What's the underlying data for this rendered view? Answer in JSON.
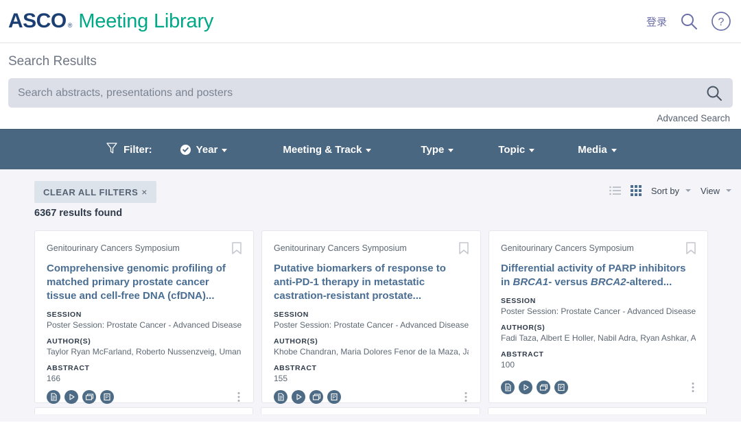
{
  "header": {
    "logo_primary": "ASCO",
    "logo_registered": "®",
    "logo_secondary": "Meeting Library",
    "login_label": "登录",
    "search_icon": "search-icon",
    "help_icon": "help-circle-icon"
  },
  "search": {
    "title": "Search Results",
    "placeholder": "Search abstracts, presentations and posters",
    "value": "",
    "submit_icon": "search-icon",
    "advanced_label": "Advanced Search"
  },
  "filter_bar": {
    "label": "Filter:",
    "funnel_icon": "filter-funnel-icon",
    "background": "#4a6782",
    "items": [
      {
        "label": "Year",
        "active": true,
        "badge_icon": "check-circle-icon"
      },
      {
        "label": "Meeting & Track",
        "active": false
      },
      {
        "label": "Type",
        "active": false
      },
      {
        "label": "Topic",
        "active": false
      },
      {
        "label": "Media",
        "active": false
      }
    ]
  },
  "results_toolbar": {
    "clear_all_label": "CLEAR ALL FILTERS",
    "clear_all_x": "×",
    "count_text": "6367 results found",
    "list_view_icon": "list-view-icon",
    "grid_view_icon": "grid-view-icon",
    "active_view": "grid",
    "sort_by_label": "Sort by",
    "view_label": "View"
  },
  "labels": {
    "session": "SESSION",
    "authors": "AUTHOR(S)",
    "abstract": "ABSTRACT",
    "bookmark_icon": "bookmark-outline-icon",
    "kebab_icon": "more-vertical-icon",
    "action_icons": [
      "document-icon",
      "video-play-icon",
      "slides-icon",
      "poster-icon"
    ]
  },
  "cards": [
    {
      "meeting": "Genitourinary Cancers Symposium",
      "title": "Comprehensive genomic profiling of matched primary prostate cancer tissue and cell-free DNA (cfDNA)...",
      "session": "Poster Session: Prostate Cancer - Advanced Disease",
      "authors": "Taylor Ryan McFarland, Roberto Nussenzveig, Umang Swa...",
      "abstract": "166"
    },
    {
      "meeting": "Genitourinary Cancers Symposium",
      "title": "Putative biomarkers of response to anti-PD-1 therapy in metastatic castration-resistant prostate...",
      "session": "Poster Session: Prostate Cancer - Advanced Disease",
      "authors": "Khobe Chandran, Maria Dolores Fenor de la Maza, Jan Re...",
      "abstract": "155"
    },
    {
      "meeting": "Genitourinary Cancers Symposium",
      "title_html": "Differential activity of PARP inhibitors in <i>BRCA1</i>- versus <i>BRCA2</i>-altered...",
      "title": "Differential activity of PARP inhibitors in BRCA1- versus BRCA2-altered...",
      "session": "Poster Session: Prostate Cancer - Advanced Disease",
      "authors": "Fadi Taza, Albert E Holler, Nabil Adra, Ryan Ashkar, Alexa...",
      "abstract": "100"
    }
  ],
  "colors": {
    "brand_navy": "#1b3f73",
    "brand_green": "#00a887",
    "filter_slate": "#4a6782",
    "page_bg": "#f4f4f9",
    "title_blue": "#4a6e93"
  }
}
